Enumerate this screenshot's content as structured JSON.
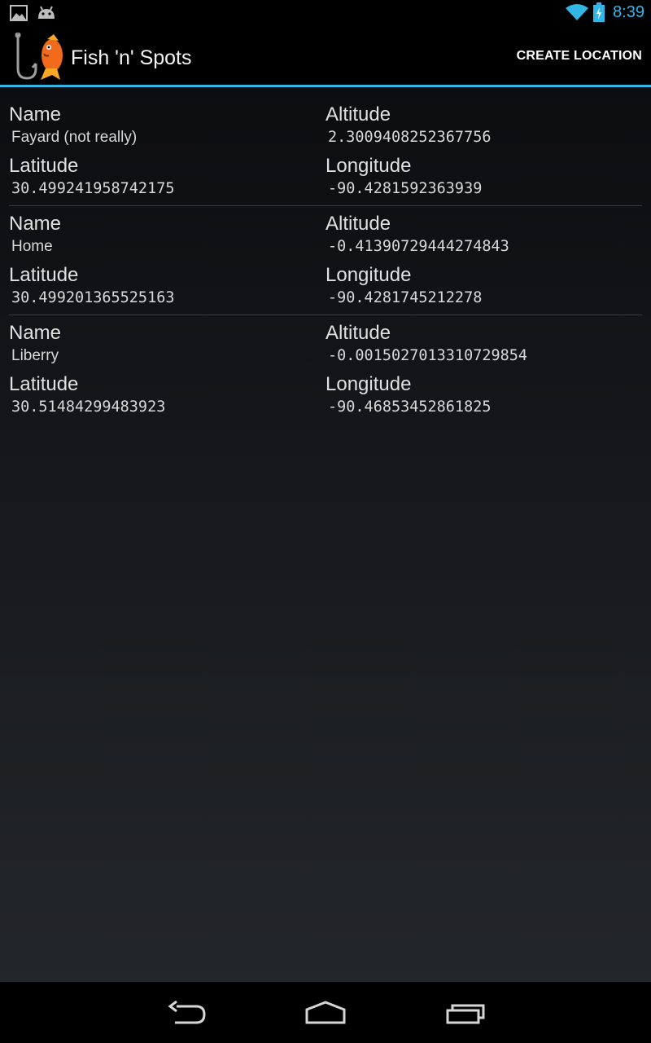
{
  "status_bar": {
    "left_icons": [
      "image-notification-icon",
      "android-notification-icon"
    ],
    "right_icons": [
      "wifi-icon",
      "battery-charging-icon"
    ],
    "time": "8:39",
    "accent_color": "#33b5e5"
  },
  "action_bar": {
    "title": "Fish 'n' Spots",
    "action_label": "CREATE LOCATION",
    "logo_icon": "fish-hook-logo-icon"
  },
  "locations": [
    {
      "name_label": "Name",
      "name": "Fayard (not really)",
      "altitude_label": "Altitude",
      "altitude": "2.3009408252367756",
      "latitude_label": "Latitude",
      "latitude": "30.499241958742175",
      "longitude_label": "Longitude",
      "longitude": "-90.4281592363939"
    },
    {
      "name_label": "Name",
      "name": "Home",
      "altitude_label": "Altitude",
      "altitude": "-0.41390729444274843",
      "latitude_label": "Latitude",
      "latitude": "30.499201365525163",
      "longitude_label": "Longitude",
      "longitude": "-90.4281745212278"
    },
    {
      "name_label": "Name",
      "name": "Liberry",
      "altitude_label": "Altitude",
      "altitude": "-0.0015027013310729854",
      "latitude_label": "Latitude",
      "latitude": "30.51484299483923",
      "longitude_label": "Longitude",
      "longitude": "-90.46853452861825"
    }
  ],
  "nav_bar": {
    "buttons": [
      "back-icon",
      "home-icon",
      "recent-apps-icon"
    ]
  }
}
